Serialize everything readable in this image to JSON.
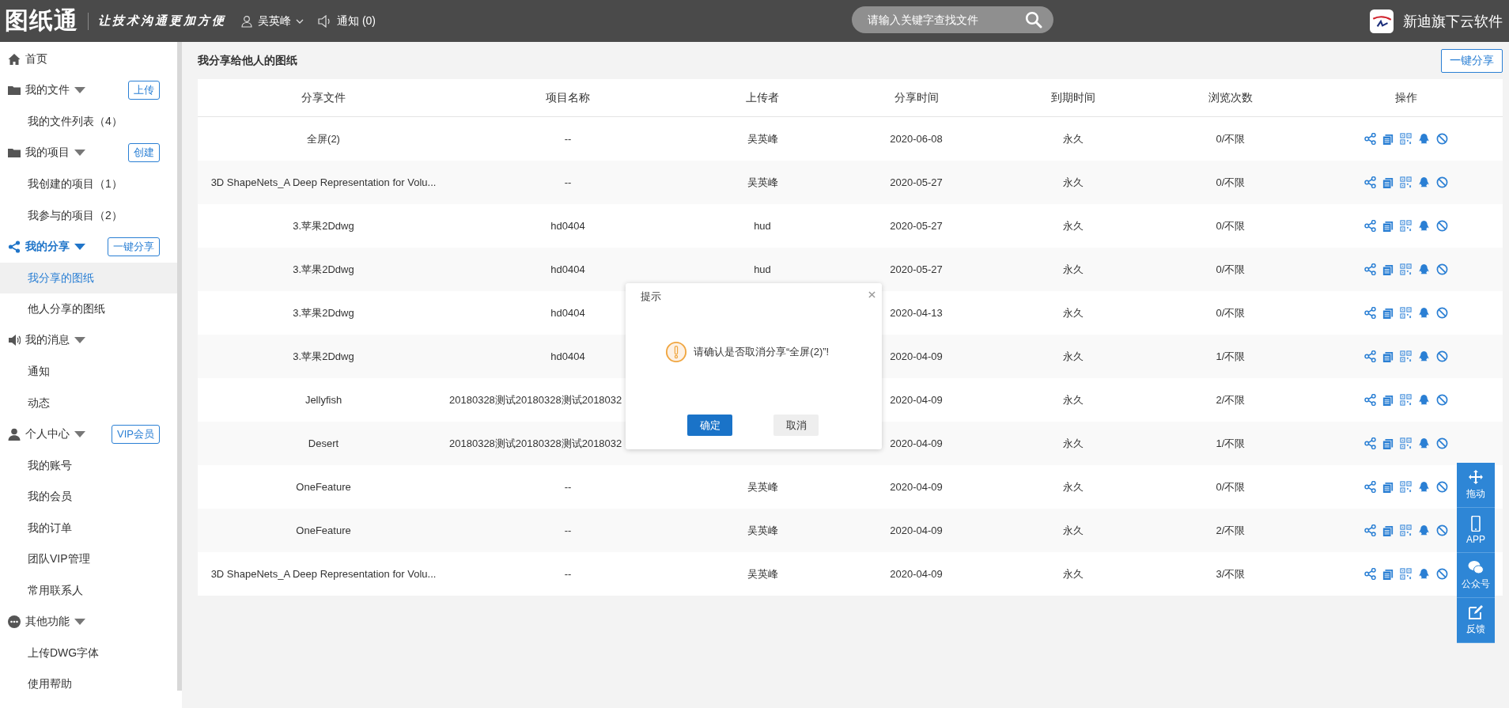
{
  "header": {
    "logo": "图纸通",
    "slogan": "让技术沟通更加方便",
    "user": "吴英峰",
    "notice": "通知 (0)",
    "search": {
      "placeholder": "请输入关键字查找文件"
    },
    "brand": "新迪旗下云软件"
  },
  "sidebar": {
    "groups": [
      {
        "label": "首页",
        "active": false
      },
      {
        "label": "我的文件",
        "active": false,
        "expanded": true,
        "button": "上传",
        "children": [
          {
            "label": "我的文件列表（4）",
            "selected": false
          }
        ]
      },
      {
        "label": "我的项目",
        "active": false,
        "expanded": true,
        "button": "创建",
        "children": [
          {
            "label": "我创建的项目（1）",
            "selected": false
          },
          {
            "label": "我参与的项目（2）",
            "selected": false
          }
        ]
      },
      {
        "label": "我的分享",
        "active": true,
        "expanded": true,
        "button": "一键分享",
        "children": [
          {
            "label": "我分享的图纸",
            "selected": true
          },
          {
            "label": "他人分享的图纸",
            "selected": false
          }
        ]
      },
      {
        "label": "我的消息",
        "active": false,
        "expanded": true,
        "children": [
          {
            "label": "通知",
            "selected": false
          },
          {
            "label": "动态",
            "selected": false
          }
        ]
      },
      {
        "label": "个人中心",
        "active": false,
        "expanded": true,
        "button": "VIP会员",
        "children": [
          {
            "label": "我的账号",
            "selected": false
          },
          {
            "label": "我的会员",
            "selected": false
          },
          {
            "label": "我的订单",
            "selected": false
          },
          {
            "label": "团队VIP管理",
            "selected": false
          },
          {
            "label": "常用联系人",
            "selected": false
          }
        ]
      },
      {
        "label": "其他功能",
        "active": false,
        "expanded": true,
        "children": [
          {
            "label": "上传DWG字体",
            "selected": false
          },
          {
            "label": "使用帮助",
            "selected": false
          }
        ]
      }
    ]
  },
  "page": {
    "title": "我分享给他人的图纸",
    "share_button": "一键分享"
  },
  "table": {
    "columns": [
      "分享文件",
      "项目名称",
      "上传者",
      "分享时间",
      "到期时间",
      "浏览次数",
      "操作"
    ],
    "rows": [
      {
        "file": "全屏(2)",
        "project": "--",
        "uploader": "吴英峰",
        "shared": "2020-06-08",
        "expires": "永久",
        "views": "0/不限"
      },
      {
        "file": "3D ShapeNets_A Deep Representation for Volu...",
        "project": "--",
        "uploader": "吴英峰",
        "shared": "2020-05-27",
        "expires": "永久",
        "views": "0/不限"
      },
      {
        "file": "3.苹果2Ddwg",
        "project": "hd0404",
        "uploader": "hud",
        "shared": "2020-05-27",
        "expires": "永久",
        "views": "0/不限"
      },
      {
        "file": "3.苹果2Ddwg",
        "project": "hd0404",
        "uploader": "hud",
        "shared": "2020-05-27",
        "expires": "永久",
        "views": "0/不限"
      },
      {
        "file": "3.苹果2Ddwg",
        "project": "hd0404",
        "shared": "2020-04-13",
        "expires": "永久",
        "views": "0/不限"
      },
      {
        "file": "3.苹果2Ddwg",
        "project": "hd0404",
        "shared": "2020-04-09",
        "expires": "永久",
        "views": "1/不限"
      },
      {
        "file": "Jellyfish",
        "project": "20180328测试20180328测试2018032",
        "shared": "2020-04-09",
        "expires": "永久",
        "views": "2/不限"
      },
      {
        "file": "Desert",
        "project": "20180328测试20180328测试2018032",
        "shared": "2020-04-09",
        "expires": "永久",
        "views": "1/不限"
      },
      {
        "file": "OneFeature",
        "project": "--",
        "uploader": "吴英峰",
        "shared": "2020-04-09",
        "expires": "永久",
        "views": "0/不限"
      },
      {
        "file": "OneFeature",
        "project": "--",
        "uploader": "吴英峰",
        "shared": "2020-04-09",
        "expires": "永久",
        "views": "2/不限"
      },
      {
        "file": "3D ShapeNets_A Deep Representation for Volu...",
        "project": "--",
        "uploader": "吴英峰",
        "shared": "2020-04-09",
        "expires": "永久",
        "views": "3/不限"
      }
    ]
  },
  "dialog": {
    "title": "提示",
    "message": "请确认是否取消分享“全屏(2)”!",
    "buttons": [
      {
        "label": "确定",
        "kind": "primary"
      },
      {
        "label": "取消",
        "kind": "secondary"
      }
    ]
  },
  "float_toolbar": [
    {
      "label": "拖动"
    },
    {
      "label": "APP"
    },
    {
      "label": "公众号"
    },
    {
      "label": "反馈"
    }
  ]
}
